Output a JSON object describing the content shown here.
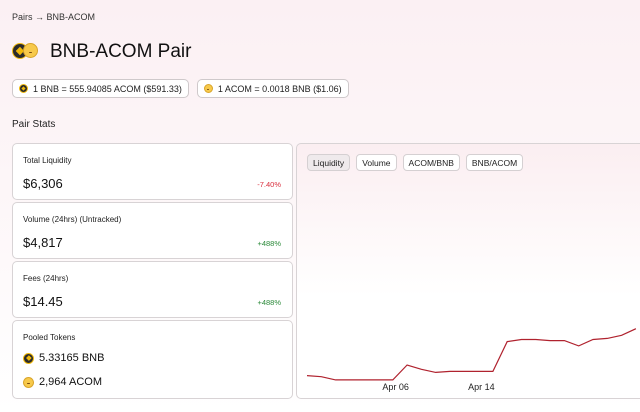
{
  "breadcrumb": {
    "items": [
      "Pairs",
      "→",
      "BNB-ACOM"
    ]
  },
  "header": {
    "title": "BNB-ACOM Pair"
  },
  "rates": [
    {
      "icon": "bnb-coin-icon",
      "text": "1 BNB = 555.94085 ACOM ($591.33)"
    },
    {
      "icon": "acom-coin-icon",
      "text": "1 ACOM = 0.0018 BNB ($1.06)"
    }
  ],
  "section": {
    "title": "Pair Stats"
  },
  "stats": {
    "liquidity": {
      "label": "Total Liquidity",
      "value": "$6,306",
      "change": "-7.40%"
    },
    "volume": {
      "label": "Volume (24hrs) (Untracked)",
      "value": "$4,817",
      "change": "+488%"
    },
    "fees": {
      "label": "Fees (24hrs)",
      "value": "$14.45",
      "change": "+488%"
    },
    "pooled": {
      "label": "Pooled Tokens",
      "tokens": [
        {
          "icon": "bnb-coin-icon",
          "text": "5.33165 BNB"
        },
        {
          "icon": "acom-coin-icon",
          "text": "2,964 ACOM"
        }
      ]
    }
  },
  "chart": {
    "tabs": [
      "Liquidity",
      "Volume",
      "ACOM/BNB",
      "BNB/ACOM"
    ],
    "active_tab": "Liquidity",
    "line_color": "#b0222e"
  },
  "chart_data": {
    "type": "line",
    "x_ticks": [
      "Apr 06",
      "Apr 14"
    ],
    "series": [
      {
        "x": [
          0,
          1,
          2,
          3,
          4,
          5,
          6,
          7,
          8,
          9,
          10,
          11,
          12,
          13,
          14,
          15,
          16,
          17,
          18,
          19,
          20,
          21,
          22,
          23
        ],
        "y": [
          4100,
          4050,
          3900,
          3900,
          3900,
          3900,
          3900,
          4600,
          4400,
          4250,
          4300,
          4300,
          4300,
          4300,
          5700,
          5800,
          5800,
          5750,
          5750,
          5500,
          5800,
          5850,
          6000,
          6306
        ]
      }
    ]
  }
}
